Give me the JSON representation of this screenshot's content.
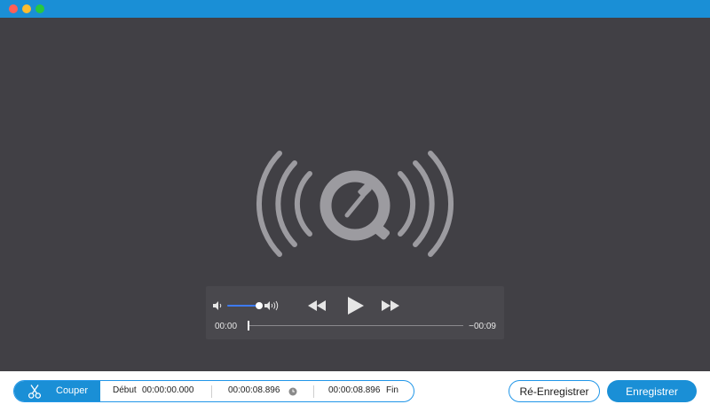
{
  "player": {
    "time_elapsed": "00:00",
    "time_remaining": "−00:09",
    "volume_level": 0.85,
    "playhead_position": 0.0
  },
  "trim": {
    "cut_label": "Couper",
    "start_label": "Début",
    "start_time": "00:00:00.000",
    "mid_time": "00:00:08.896",
    "end_time": "00:00:08.896",
    "end_label": "Fin"
  },
  "actions": {
    "rerecord_label": "Ré-Enregistrer",
    "save_label": "Enregistrer"
  },
  "colors": {
    "accent": "#1a8fd6",
    "viewer_bg": "#414045",
    "logo": "#9c9ba0"
  },
  "icons": [
    "close-dot",
    "minimize-dot",
    "zoom-dot",
    "quicktime-logo",
    "volume-low-icon",
    "volume-high-icon",
    "rewind-icon",
    "play-icon",
    "fast-forward-icon",
    "scissors-icon",
    "clock-icon"
  ]
}
